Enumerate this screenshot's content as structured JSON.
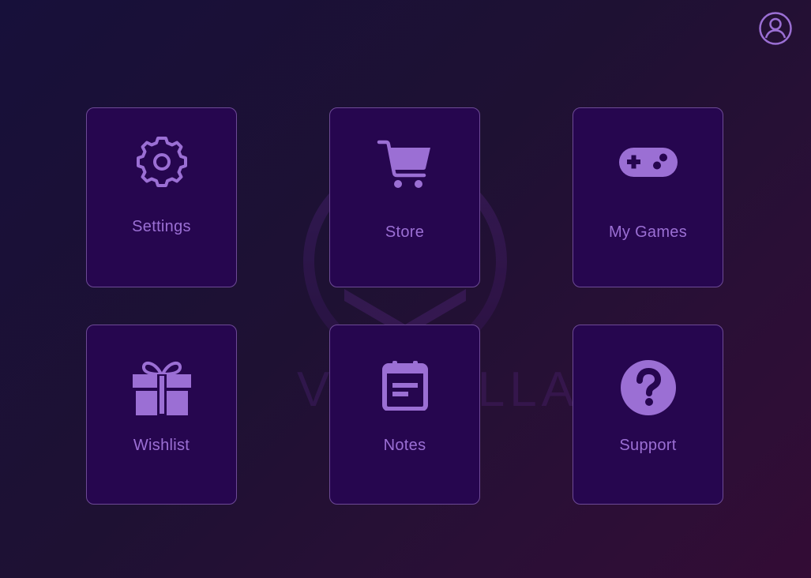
{
  "colors": {
    "tile_bg": "#26064f",
    "tile_border": "#6d4a96",
    "accent": "#9b6fd4",
    "background_start": "#17103a",
    "background_end": "#330c35"
  },
  "header": {
    "profile_icon": "user-circle-icon"
  },
  "watermark": {
    "logo_icon": "shield-v-logo",
    "text": "VALHALLA"
  },
  "menu": {
    "tiles": [
      {
        "label": "Settings",
        "icon": "gear-icon"
      },
      {
        "label": "Store",
        "icon": "shopping-cart-icon"
      },
      {
        "label": "My Games",
        "icon": "gamepad-icon"
      },
      {
        "label": "Wishlist",
        "icon": "gift-icon"
      },
      {
        "label": "Notes",
        "icon": "calendar-note-icon"
      },
      {
        "label": "Support",
        "icon": "help-circle-icon"
      }
    ]
  }
}
